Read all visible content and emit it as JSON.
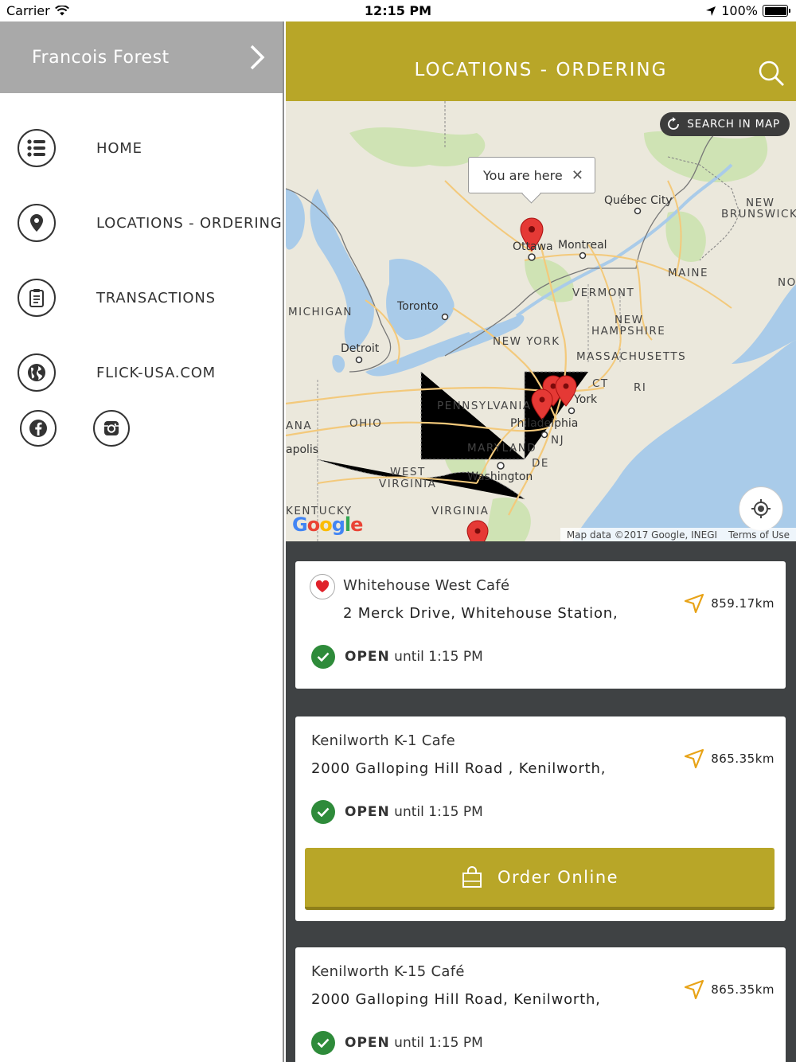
{
  "status_bar": {
    "carrier": "Carrier",
    "time": "12:15 PM",
    "battery": "100%"
  },
  "sidebar": {
    "user_name": "Francois Forest",
    "items": [
      {
        "label": "HOME",
        "icon": "list-icon"
      },
      {
        "label": "LOCATIONS - ORDERING",
        "icon": "location-pin-icon"
      },
      {
        "label": "TRANSACTIONS",
        "icon": "clipboard-icon"
      },
      {
        "label": "FLICK-USA.COM",
        "icon": "globe-icon"
      }
    ],
    "social": [
      "facebook-icon",
      "instagram-icon"
    ]
  },
  "header": {
    "title": "LOCATIONS - ORDERING"
  },
  "map": {
    "search_in_map": "SEARCH IN MAP",
    "callout": "You are here",
    "attribution": "Map data ©2017 Google, INEGI",
    "terms": "Terms of Use",
    "logo": "Google",
    "labels": {
      "ottawa": "Ottawa",
      "montreal": "Montreal",
      "quebec": "Québec City",
      "new_brunswick_1": "NEW",
      "new_brunswick_2": "BRUNSWICK",
      "no": "NO",
      "maine": "MAINE",
      "vermont": "VERMONT",
      "nh1": "NEW",
      "nh2": "HAMPSHIRE",
      "massachusetts": "MASSACHUSETTS",
      "ct": "CT",
      "ri": "RI",
      "toronto": "Toronto",
      "michigan": "MICHIGAN",
      "detroit": "Detroit",
      "new_york": "NEW YORK",
      "york": "York",
      "pennsylvania": "PENNSYLVANIA",
      "philadelphia": "Philadelphia",
      "nj": "NJ",
      "ohio": "OHIO",
      "ana": "ANA",
      "apolis": "apolis",
      "maryland": "MARYLAND",
      "de": "DE",
      "washington": "Washington",
      "west1": "WEST",
      "west2": "VIRGINIA",
      "kentucky": "KENTUCKY",
      "virginia": "VIRGINIA"
    }
  },
  "colors": {
    "accent": "#b8a628",
    "open_green": "#2e8b3a",
    "distance_arrow": "#e8a317",
    "heart": "#e0222a"
  },
  "locations": [
    {
      "name": "Whitehouse West Café",
      "address": "2 Merck Drive, Whitehouse Station,",
      "distance": "859.17km",
      "open_label": "OPEN",
      "hours": "until 1:15 PM",
      "favorite": true
    },
    {
      "name": "Kenilworth K-1 Cafe",
      "address": "2000 Galloping Hill Road , Kenilworth,",
      "distance": "865.35km",
      "open_label": "OPEN",
      "hours": "until 1:15 PM",
      "order_label": "Order Online"
    },
    {
      "name": "Kenilworth K-15 Café",
      "address": "2000 Galloping Hill Road, Kenilworth,",
      "distance": "865.35km",
      "open_label": "OPEN",
      "hours": "until 1:15 PM"
    }
  ]
}
